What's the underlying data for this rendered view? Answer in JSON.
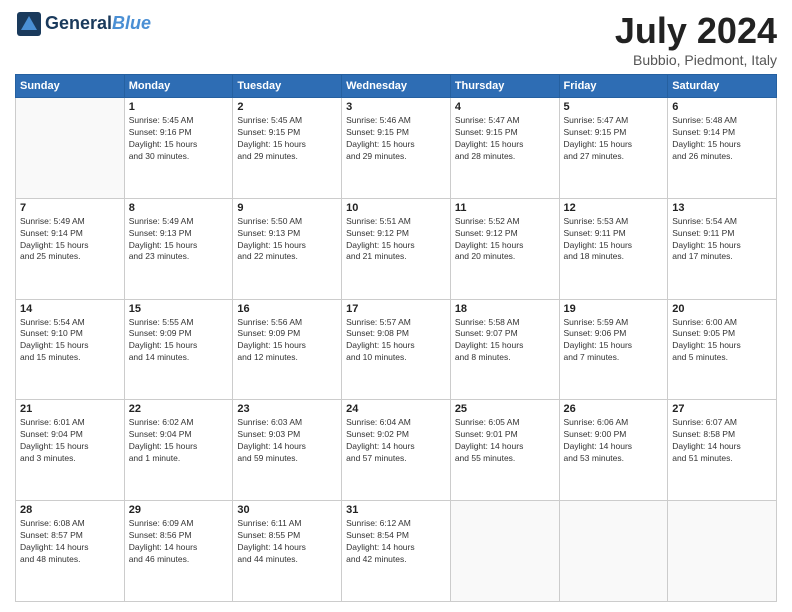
{
  "header": {
    "logo_general": "General",
    "logo_blue": "Blue",
    "main_title": "July 2024",
    "subtitle": "Bubbio, Piedmont, Italy"
  },
  "days_of_week": [
    "Sunday",
    "Monday",
    "Tuesday",
    "Wednesday",
    "Thursday",
    "Friday",
    "Saturday"
  ],
  "weeks": [
    [
      {
        "day": "",
        "info": ""
      },
      {
        "day": "1",
        "info": "Sunrise: 5:45 AM\nSunset: 9:16 PM\nDaylight: 15 hours\nand 30 minutes."
      },
      {
        "day": "2",
        "info": "Sunrise: 5:45 AM\nSunset: 9:15 PM\nDaylight: 15 hours\nand 29 minutes."
      },
      {
        "day": "3",
        "info": "Sunrise: 5:46 AM\nSunset: 9:15 PM\nDaylight: 15 hours\nand 29 minutes."
      },
      {
        "day": "4",
        "info": "Sunrise: 5:47 AM\nSunset: 9:15 PM\nDaylight: 15 hours\nand 28 minutes."
      },
      {
        "day": "5",
        "info": "Sunrise: 5:47 AM\nSunset: 9:15 PM\nDaylight: 15 hours\nand 27 minutes."
      },
      {
        "day": "6",
        "info": "Sunrise: 5:48 AM\nSunset: 9:14 PM\nDaylight: 15 hours\nand 26 minutes."
      }
    ],
    [
      {
        "day": "7",
        "info": "Sunrise: 5:49 AM\nSunset: 9:14 PM\nDaylight: 15 hours\nand 25 minutes."
      },
      {
        "day": "8",
        "info": "Sunrise: 5:49 AM\nSunset: 9:13 PM\nDaylight: 15 hours\nand 23 minutes."
      },
      {
        "day": "9",
        "info": "Sunrise: 5:50 AM\nSunset: 9:13 PM\nDaylight: 15 hours\nand 22 minutes."
      },
      {
        "day": "10",
        "info": "Sunrise: 5:51 AM\nSunset: 9:12 PM\nDaylight: 15 hours\nand 21 minutes."
      },
      {
        "day": "11",
        "info": "Sunrise: 5:52 AM\nSunset: 9:12 PM\nDaylight: 15 hours\nand 20 minutes."
      },
      {
        "day": "12",
        "info": "Sunrise: 5:53 AM\nSunset: 9:11 PM\nDaylight: 15 hours\nand 18 minutes."
      },
      {
        "day": "13",
        "info": "Sunrise: 5:54 AM\nSunset: 9:11 PM\nDaylight: 15 hours\nand 17 minutes."
      }
    ],
    [
      {
        "day": "14",
        "info": "Sunrise: 5:54 AM\nSunset: 9:10 PM\nDaylight: 15 hours\nand 15 minutes."
      },
      {
        "day": "15",
        "info": "Sunrise: 5:55 AM\nSunset: 9:09 PM\nDaylight: 15 hours\nand 14 minutes."
      },
      {
        "day": "16",
        "info": "Sunrise: 5:56 AM\nSunset: 9:09 PM\nDaylight: 15 hours\nand 12 minutes."
      },
      {
        "day": "17",
        "info": "Sunrise: 5:57 AM\nSunset: 9:08 PM\nDaylight: 15 hours\nand 10 minutes."
      },
      {
        "day": "18",
        "info": "Sunrise: 5:58 AM\nSunset: 9:07 PM\nDaylight: 15 hours\nand 8 minutes."
      },
      {
        "day": "19",
        "info": "Sunrise: 5:59 AM\nSunset: 9:06 PM\nDaylight: 15 hours\nand 7 minutes."
      },
      {
        "day": "20",
        "info": "Sunrise: 6:00 AM\nSunset: 9:05 PM\nDaylight: 15 hours\nand 5 minutes."
      }
    ],
    [
      {
        "day": "21",
        "info": "Sunrise: 6:01 AM\nSunset: 9:04 PM\nDaylight: 15 hours\nand 3 minutes."
      },
      {
        "day": "22",
        "info": "Sunrise: 6:02 AM\nSunset: 9:04 PM\nDaylight: 15 hours\nand 1 minute."
      },
      {
        "day": "23",
        "info": "Sunrise: 6:03 AM\nSunset: 9:03 PM\nDaylight: 14 hours\nand 59 minutes."
      },
      {
        "day": "24",
        "info": "Sunrise: 6:04 AM\nSunset: 9:02 PM\nDaylight: 14 hours\nand 57 minutes."
      },
      {
        "day": "25",
        "info": "Sunrise: 6:05 AM\nSunset: 9:01 PM\nDaylight: 14 hours\nand 55 minutes."
      },
      {
        "day": "26",
        "info": "Sunrise: 6:06 AM\nSunset: 9:00 PM\nDaylight: 14 hours\nand 53 minutes."
      },
      {
        "day": "27",
        "info": "Sunrise: 6:07 AM\nSunset: 8:58 PM\nDaylight: 14 hours\nand 51 minutes."
      }
    ],
    [
      {
        "day": "28",
        "info": "Sunrise: 6:08 AM\nSunset: 8:57 PM\nDaylight: 14 hours\nand 48 minutes."
      },
      {
        "day": "29",
        "info": "Sunrise: 6:09 AM\nSunset: 8:56 PM\nDaylight: 14 hours\nand 46 minutes."
      },
      {
        "day": "30",
        "info": "Sunrise: 6:11 AM\nSunset: 8:55 PM\nDaylight: 14 hours\nand 44 minutes."
      },
      {
        "day": "31",
        "info": "Sunrise: 6:12 AM\nSunset: 8:54 PM\nDaylight: 14 hours\nand 42 minutes."
      },
      {
        "day": "",
        "info": ""
      },
      {
        "day": "",
        "info": ""
      },
      {
        "day": "",
        "info": ""
      }
    ]
  ]
}
